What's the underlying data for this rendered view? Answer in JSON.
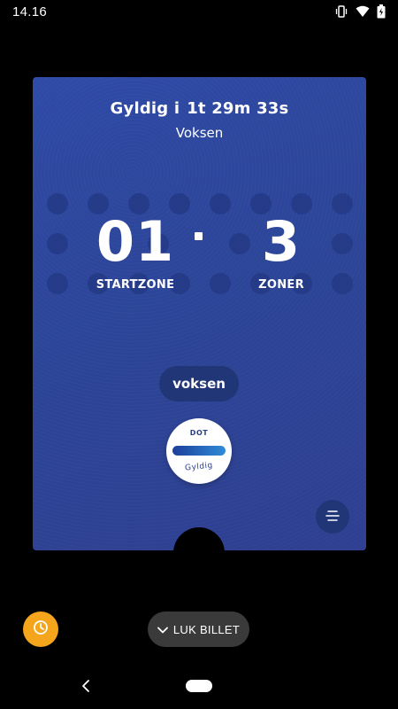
{
  "status_bar": {
    "time": "14.16",
    "icons": [
      "vibrate-icon",
      "wifi-icon",
      "battery-icon"
    ]
  },
  "ticket": {
    "valid_prefix": "Gyldig i",
    "valid_time": "1t 29m 33s",
    "passenger_type": "Voksen",
    "start_zone": "01",
    "start_zone_label": "STARTZONE",
    "zone_count": "3",
    "zone_count_label": "ZONER",
    "passenger_pill": "voksen",
    "badge_brand": "DOT",
    "badge_status": "Gyldig",
    "colors": {
      "card": "#2c4597",
      "pill": "#213677",
      "badge_bar": "#2f8cd8"
    }
  },
  "actions": {
    "clock_icon": "clock-icon",
    "close_ticket_label": "LUK BILLET",
    "close_ticket_icon": "chevron-down-icon",
    "clock_color": "#f5a51c"
  },
  "nav": {
    "back_icon": "back-icon",
    "home_icon": "home-pill-icon"
  }
}
